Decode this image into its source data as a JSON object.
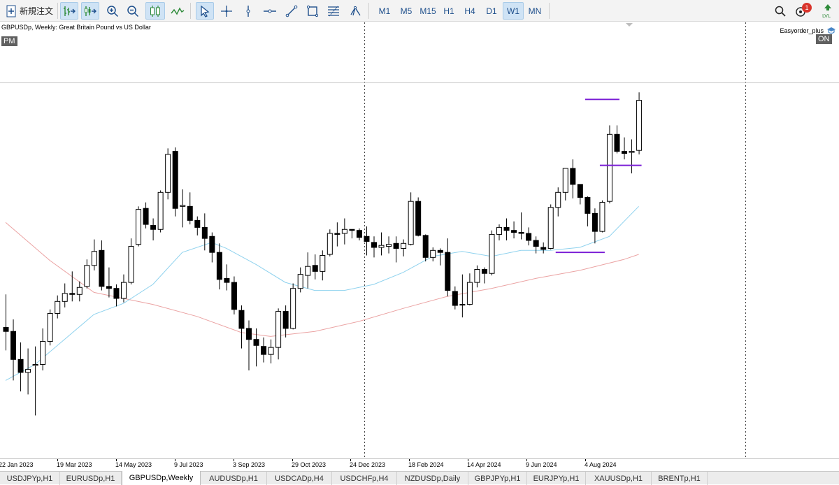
{
  "toolbar": {
    "new_order_label": "新規注文",
    "timeframes": [
      {
        "label": "M1",
        "active": false
      },
      {
        "label": "M5",
        "active": false
      },
      {
        "label": "M15",
        "active": false
      },
      {
        "label": "H1",
        "active": false
      },
      {
        "label": "H4",
        "active": false
      },
      {
        "label": "D1",
        "active": false
      },
      {
        "label": "W1",
        "active": true
      },
      {
        "label": "MN",
        "active": false
      }
    ],
    "notification_count": "1",
    "tools": [
      "new-order-icon",
      "bar-chart-icon",
      "candles-toggle-icon",
      "zoom-in-icon",
      "zoom-out-icon",
      "candlestick-icon",
      "line-chart-icon",
      "cursor-icon",
      "crosshair-icon",
      "vertical-line-icon",
      "horizontal-line-icon",
      "trendline-icon",
      "rectangle-icon",
      "fibonacci-icon",
      "andrews-pitchfork-icon",
      "search-icon",
      "notifications-icon",
      "lvl-icon"
    ]
  },
  "chart": {
    "title": "GBPUSDp, Weekly:  Great Britain Pound vs US Dollar",
    "session_badge": "PM",
    "ea_name": "Easyorder_plus",
    "ea_status": "ON"
  },
  "chart_data": {
    "type": "candlestick",
    "symbol": "GBPUSDp",
    "timeframe": "Weekly",
    "xlabels": [
      "22 Jan 2023",
      "19 Mar 2023",
      "14 May 2023",
      "9 Jul 2023",
      "3 Sep 2023",
      "29 Oct 2023",
      "24 Dec 2023",
      "18 Feb 2024",
      "14 Apr 2024",
      "9 Jun 2024",
      "4 Aug 2024"
    ],
    "candles": [
      [
        1.2245,
        1.241,
        1.213,
        1.2225
      ],
      [
        1.2225,
        1.2285,
        1.198,
        1.2085
      ],
      [
        1.2085,
        1.217,
        1.1925,
        1.202
      ],
      [
        1.202,
        1.214,
        1.191,
        1.2035
      ],
      [
        1.2055,
        1.215,
        1.1805,
        1.206
      ],
      [
        1.206,
        1.224,
        1.203,
        1.2175
      ],
      [
        1.2175,
        1.2335,
        1.2155,
        1.2315
      ],
      [
        1.2315,
        1.2405,
        1.229,
        1.2375
      ],
      [
        1.2375,
        1.2465,
        1.2345,
        1.2415
      ],
      [
        1.2415,
        1.2525,
        1.2375,
        1.241
      ],
      [
        1.241,
        1.2475,
        1.2375,
        1.2445
      ],
      [
        1.245,
        1.2585,
        1.244,
        1.2555
      ],
      [
        1.2555,
        1.2685,
        1.253,
        1.2625
      ],
      [
        1.263,
        1.268,
        1.243,
        1.245
      ],
      [
        1.245,
        1.2545,
        1.2395,
        1.244
      ],
      [
        1.244,
        1.246,
        1.235,
        1.239
      ],
      [
        1.239,
        1.251,
        1.237,
        1.247
      ],
      [
        1.247,
        1.269,
        1.246,
        1.265
      ],
      [
        1.266,
        1.285,
        1.265,
        1.2835
      ],
      [
        1.284,
        1.287,
        1.274,
        1.276
      ],
      [
        1.2755,
        1.279,
        1.268,
        1.2735
      ],
      [
        1.2735,
        1.293,
        1.272,
        1.292
      ],
      [
        1.292,
        1.314,
        1.2885,
        1.311
      ],
      [
        1.3125,
        1.3145,
        1.28,
        1.284
      ],
      [
        1.285,
        1.2935,
        1.2745,
        1.2855
      ],
      [
        1.285,
        1.292,
        1.276,
        1.278
      ],
      [
        1.278,
        1.28,
        1.2705,
        1.2745
      ],
      [
        1.2745,
        1.2815,
        1.263,
        1.269
      ],
      [
        1.27,
        1.272,
        1.257,
        1.262
      ],
      [
        1.262,
        1.2665,
        1.2435,
        1.2485
      ],
      [
        1.249,
        1.256,
        1.243,
        1.247
      ],
      [
        1.247,
        1.25,
        1.231,
        1.2335
      ],
      [
        1.233,
        1.2355,
        1.214,
        1.224
      ],
      [
        1.224,
        1.228,
        1.203,
        1.2185
      ],
      [
        1.2185,
        1.224,
        1.205,
        1.2155
      ],
      [
        1.215,
        1.2195,
        1.207,
        1.211
      ],
      [
        1.211,
        1.2185,
        1.2065,
        1.2145
      ],
      [
        1.2145,
        1.234,
        1.2085,
        1.2325
      ],
      [
        1.2325,
        1.2355,
        1.2195,
        1.224
      ],
      [
        1.224,
        1.2465,
        1.2235,
        1.244
      ],
      [
        1.244,
        1.2545,
        1.242,
        1.251
      ],
      [
        1.2505,
        1.262,
        1.244,
        1.255
      ],
      [
        1.2555,
        1.261,
        1.2485,
        1.2525
      ],
      [
        1.2525,
        1.263,
        1.248,
        1.2605
      ],
      [
        1.261,
        1.2735,
        1.26,
        1.2715
      ],
      [
        1.2715,
        1.277,
        1.265,
        1.271
      ],
      [
        1.2715,
        1.279,
        1.266,
        1.2735
      ],
      [
        1.2735,
        1.273,
        1.269,
        1.273
      ],
      [
        1.273,
        1.274,
        1.268,
        1.2695
      ],
      [
        1.27,
        1.275,
        1.2605,
        1.2675
      ],
      [
        1.267,
        1.27,
        1.2595,
        1.2645
      ],
      [
        1.2645,
        1.272,
        1.2605,
        1.2655
      ],
      [
        1.265,
        1.27,
        1.2615,
        1.266
      ],
      [
        1.2665,
        1.27,
        1.257,
        1.264
      ],
      [
        1.264,
        1.2685,
        1.26,
        1.2665
      ],
      [
        1.266,
        1.292,
        1.2655,
        1.2875
      ],
      [
        1.2875,
        1.2895,
        1.27,
        1.2705
      ],
      [
        1.2705,
        1.271,
        1.2575,
        1.2595
      ],
      [
        1.2595,
        1.2645,
        1.2575,
        1.263
      ],
      [
        1.263,
        1.264,
        1.2555,
        1.262
      ],
      [
        1.262,
        1.269,
        1.24,
        1.243
      ],
      [
        1.2425,
        1.245,
        1.2335,
        1.2355
      ],
      [
        1.236,
        1.251,
        1.2295,
        1.236
      ],
      [
        1.236,
        1.2515,
        1.2355,
        1.247
      ],
      [
        1.247,
        1.2555,
        1.2445,
        1.2535
      ],
      [
        1.2535,
        1.2545,
        1.2465,
        1.2515
      ],
      [
        1.2515,
        1.273,
        1.2505,
        1.271
      ],
      [
        1.271,
        1.276,
        1.268,
        1.2745
      ],
      [
        1.2745,
        1.279,
        1.268,
        1.273
      ],
      [
        1.273,
        1.2775,
        1.269,
        1.272
      ],
      [
        1.272,
        1.282,
        1.2685,
        1.2715
      ],
      [
        1.2715,
        1.2745,
        1.2655,
        1.268
      ],
      [
        1.268,
        1.27,
        1.2615,
        1.265
      ],
      [
        1.2645,
        1.267,
        1.2615,
        1.2635
      ],
      [
        1.264,
        1.286,
        1.2635,
        1.2845
      ],
      [
        1.2845,
        1.2945,
        1.28,
        1.292
      ],
      [
        1.292,
        1.304,
        1.288,
        1.304
      ],
      [
        1.304,
        1.3085,
        1.289,
        1.296
      ],
      [
        1.296,
        1.296,
        1.286,
        1.2895
      ],
      [
        1.2895,
        1.29,
        1.275,
        1.2815
      ],
      [
        1.2815,
        1.284,
        1.2665,
        1.2725
      ],
      [
        1.2725,
        1.288,
        1.272,
        1.287
      ],
      [
        1.2875,
        1.3255,
        1.2865,
        1.321
      ],
      [
        1.321,
        1.3255,
        1.3115,
        1.3125
      ],
      [
        1.3125,
        1.3195,
        1.3085,
        1.3115
      ],
      [
        1.312,
        1.3185,
        1.3015,
        1.3125
      ],
      [
        1.313,
        1.342,
        1.311,
        1.338
      ]
    ],
    "ma_fast": [
      [
        0,
        1.198
      ],
      [
        4,
        1.206
      ],
      [
        8,
        1.2185
      ],
      [
        12,
        1.231
      ],
      [
        16,
        1.2365
      ],
      [
        20,
        1.246
      ],
      [
        24,
        1.262
      ],
      [
        28,
        1.267
      ],
      [
        30,
        1.264
      ],
      [
        34,
        1.256
      ],
      [
        38,
        1.247
      ],
      [
        42,
        1.243
      ],
      [
        46,
        1.243
      ],
      [
        50,
        1.246
      ],
      [
        54,
        1.252
      ],
      [
        58,
        1.26
      ],
      [
        62,
        1.2625
      ],
      [
        66,
        1.26
      ],
      [
        70,
        1.263
      ],
      [
        74,
        1.263
      ],
      [
        78,
        1.2645
      ],
      [
        82,
        1.27
      ],
      [
        86,
        1.285
      ]
    ],
    "ma_slow": [
      [
        0,
        1.277
      ],
      [
        6,
        1.258
      ],
      [
        12,
        1.242
      ],
      [
        20,
        1.236
      ],
      [
        26,
        1.23
      ],
      [
        32,
        1.222
      ],
      [
        36,
        1.22
      ],
      [
        42,
        1.2225
      ],
      [
        48,
        1.2275
      ],
      [
        54,
        1.234
      ],
      [
        60,
        1.24
      ],
      [
        66,
        1.244
      ],
      [
        72,
        1.249
      ],
      [
        78,
        1.253
      ],
      [
        84,
        1.2585
      ],
      [
        86,
        1.261
      ]
    ],
    "hlines": [
      {
        "value": 1.3385,
        "color": "#7b1fd6"
      },
      {
        "value": 1.3055,
        "color": "#7b1fd6"
      },
      {
        "value": 1.262,
        "color": "#7b1fd6"
      }
    ],
    "ylim": [
      1.159,
      1.377
    ],
    "grid": false,
    "colors": {
      "bull": "#ffffff",
      "bear": "#000000",
      "ma_fast": "#8fd2ee",
      "ma_slow": "#eba3a3"
    }
  },
  "tabs": [
    {
      "label": "USDJPYp,H1",
      "active": false
    },
    {
      "label": "EURUSDp,H1",
      "active": false
    },
    {
      "label": "GBPUSDp,Weekly",
      "active": true
    },
    {
      "label": "AUDUSDp,H1",
      "active": false
    },
    {
      "label": "USDCADp,H4",
      "active": false
    },
    {
      "label": "USDCHFp,H4",
      "active": false
    },
    {
      "label": "NZDUSDp,Daily",
      "active": false
    },
    {
      "label": "GBPJPYp,H1",
      "active": false
    },
    {
      "label": "EURJPYp,H1",
      "active": false
    },
    {
      "label": "XAUUSDp,H1",
      "active": false
    },
    {
      "label": "BRENTp,H1",
      "active": false
    }
  ]
}
